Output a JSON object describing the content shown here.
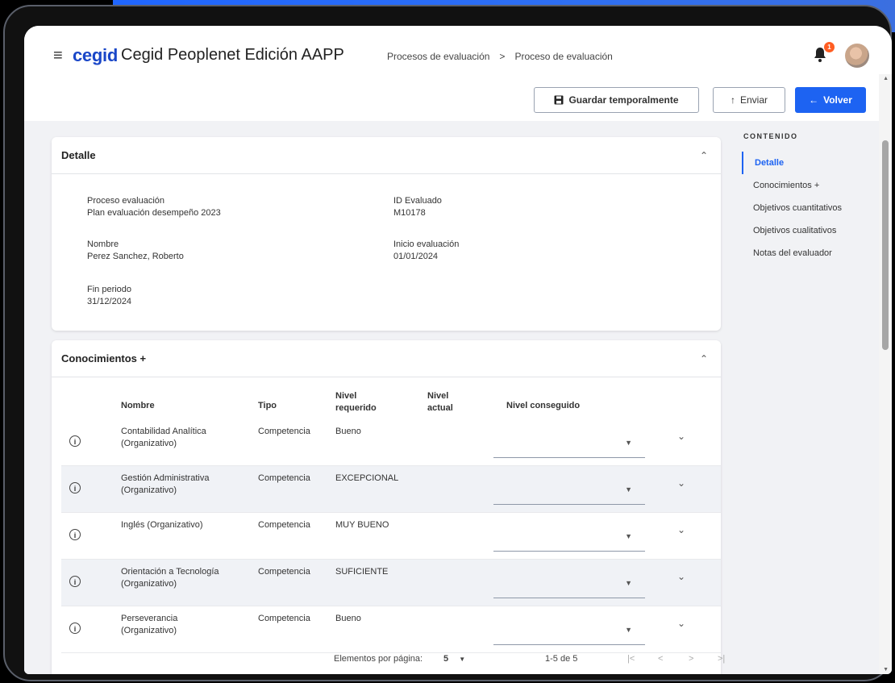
{
  "header": {
    "menu_icon": "hamburger-icon",
    "logo": "cegid",
    "app_title": "Cegid Peoplenet Edición AAPP",
    "breadcrumb": [
      "Procesos de evaluación",
      "Proceso de evaluación"
    ],
    "breadcrumb_separator": ">",
    "notification_count": "1"
  },
  "toolbar": {
    "save_label": "Guardar temporalmente",
    "send_label": "Enviar",
    "back_label": "Volver",
    "accent_color": "#1d63f2"
  },
  "detalle": {
    "title": "Detalle",
    "proceso_label": "Proceso evaluación",
    "proceso_value": "Plan evaluación desempeño 2023",
    "id_label": "ID Evaluado",
    "id_value": "M10178",
    "nombre_label": "Nombre",
    "nombre_value": "Perez Sanchez, Roberto",
    "inicio_label": "Inicio evaluación",
    "inicio_value": "01/01/2024",
    "fin_label": "Fin periodo",
    "fin_value": "31/12/2024"
  },
  "conocimientos": {
    "title": "Conocimientos +",
    "columns": {
      "nombre": "Nombre",
      "tipo": "Tipo",
      "nivel_requerido_1": "Nivel",
      "nivel_requerido_2": "requerido",
      "nivel_actual_1": "Nivel",
      "nivel_actual_2": "actual",
      "nivel_conseguido": "Nivel conseguido"
    },
    "rows": [
      {
        "nombre1": "Contabilidad Analítica",
        "nombre2": "(Organizativo)",
        "tipo": "Competencia",
        "nivel_requerido": "Bueno"
      },
      {
        "nombre1": "Gestión Administrativa",
        "nombre2": "(Organizativo)",
        "tipo": "Competencia",
        "nivel_requerido": "EXCEPCIONAL"
      },
      {
        "nombre1": "Inglés (Organizativo)",
        "nombre2": "",
        "tipo": "Competencia",
        "nivel_requerido": "MUY BUENO"
      },
      {
        "nombre1": "Orientación a Tecnología",
        "nombre2": "(Organizativo)",
        "tipo": "Competencia",
        "nivel_requerido": "SUFICIENTE"
      },
      {
        "nombre1": "Perseverancia",
        "nombre2": "(Organizativo)",
        "tipo": "Competencia",
        "nivel_requerido": "Bueno"
      }
    ],
    "pager": {
      "items_label": "Elementos por página:",
      "page_size": "5",
      "range": "1-5 de 5"
    }
  },
  "toc": {
    "title": "CONTENIDO",
    "items": [
      "Detalle",
      "Conocimientos +",
      "Objetivos cuantitativos",
      "Objetivos cualitativos",
      "Notas del evaluador"
    ]
  }
}
